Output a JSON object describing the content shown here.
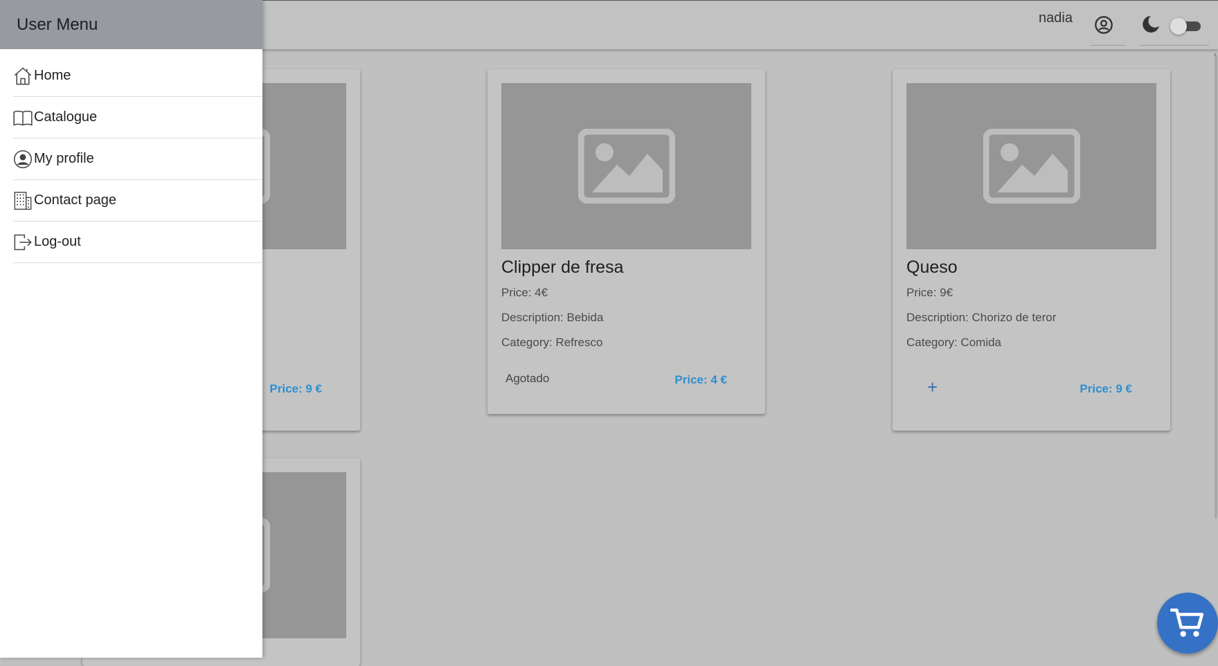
{
  "header": {
    "username": "nadia",
    "profile_icon": "account-circle-icon",
    "theme_icon": "moon-icon",
    "theme_toggle": "off"
  },
  "drawer": {
    "title": "User Menu",
    "items": [
      {
        "label": "Home",
        "icon": "home-icon"
      },
      {
        "label": "Catalogue",
        "icon": "book-icon"
      },
      {
        "label": "My profile",
        "icon": "user-circle-icon"
      },
      {
        "label": "Contact page",
        "icon": "building-icon"
      },
      {
        "label": "Log-out",
        "icon": "logout-icon"
      }
    ]
  },
  "products": [
    {
      "price_badge": "Price: 9 €"
    },
    {
      "title": "Clipper de fresa",
      "price": "Price: 4€",
      "description": "Description: Bebida",
      "category": "Category: Refresco",
      "status": "Agotado",
      "price_badge": "Price: 4 €"
    },
    {
      "title": "Queso",
      "price": "Price: 9€",
      "description": "Description: Chorizo de teror",
      "category": "Category: Comida",
      "add_label": "+",
      "price_badge": "Price: 9 €"
    }
  ],
  "cart": {
    "icon": "shopping-cart-icon"
  },
  "colors": {
    "drawer_header": "#979aa0",
    "price_text": "#2c8fcf",
    "cart_fab": "#3572c6",
    "overlay_bg": "#c0c0c0"
  }
}
